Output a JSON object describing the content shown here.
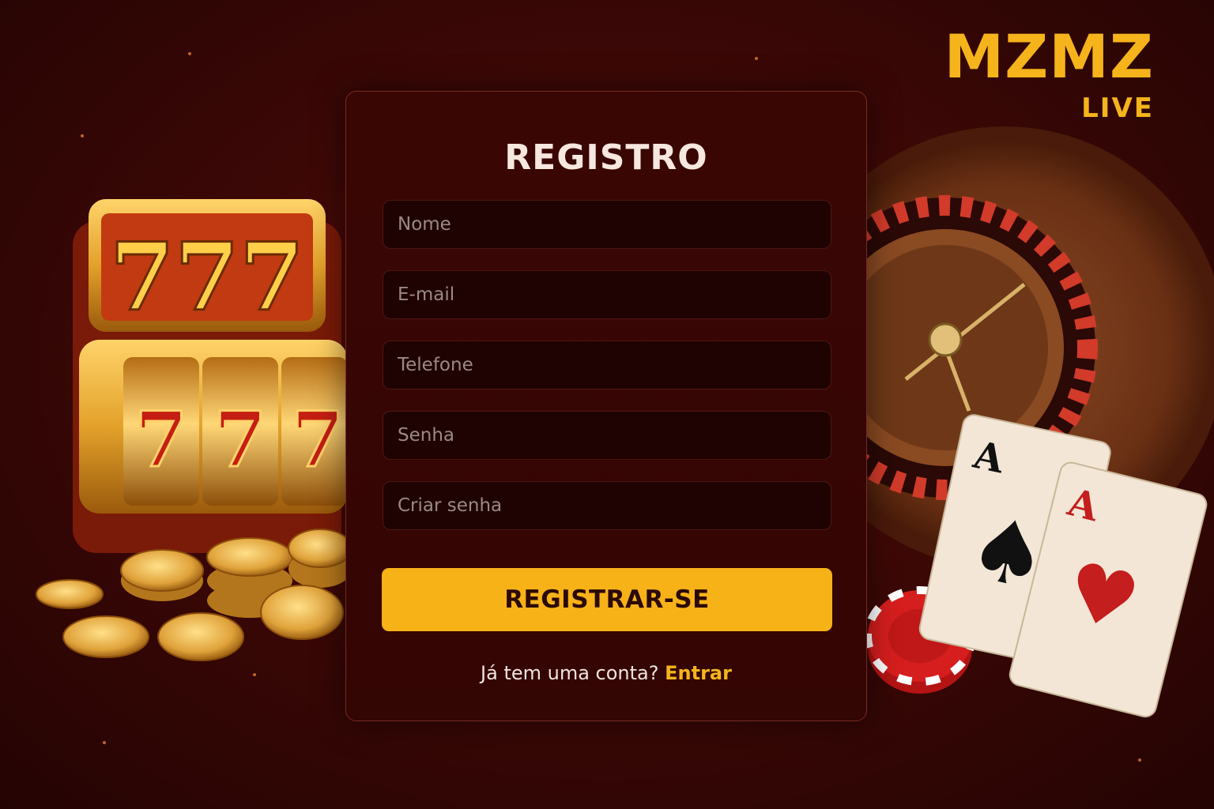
{
  "brand": {
    "name": "MZMZ",
    "tagline": "LIVE",
    "accent": "#f5b41b"
  },
  "illustrations": {
    "slot_machine_top": "777",
    "reel_symbols": [
      "7",
      "7",
      "7"
    ],
    "card_rank": "A"
  },
  "form": {
    "title": "REGISTRO",
    "fields": [
      {
        "placeholder": "Nome",
        "value": ""
      },
      {
        "placeholder": "E-mail",
        "value": ""
      },
      {
        "placeholder": "Telefone",
        "value": ""
      },
      {
        "placeholder": "Senha",
        "value": ""
      },
      {
        "placeholder": "Criar senha",
        "value": ""
      }
    ],
    "submit_label": "REGISTRAR-SE",
    "login_prompt": "Já tem uma conta?",
    "login_link": "Entrar"
  },
  "colors": {
    "background": "#3d0806",
    "button": "#f7b218",
    "card": "#3a0604"
  }
}
